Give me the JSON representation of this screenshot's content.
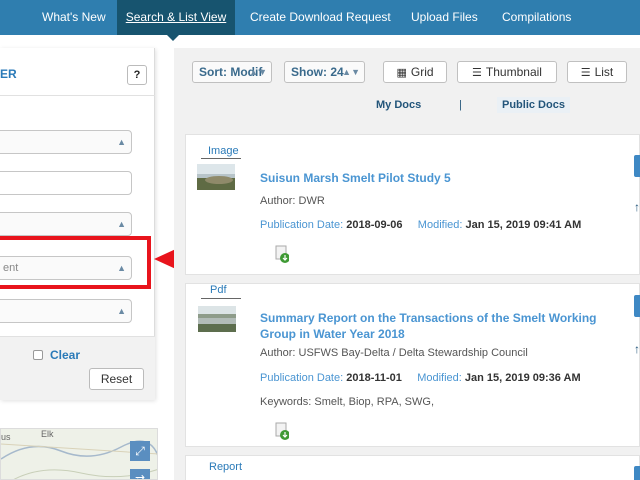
{
  "nav": {
    "items": [
      {
        "label": "What's New"
      },
      {
        "label": "Search & List View",
        "active": true
      },
      {
        "label": "Create Download Request"
      },
      {
        "label": "Upload Files"
      },
      {
        "label": "Compilations"
      }
    ],
    "colors": {
      "bar": "#2f7eaf",
      "active": "#17546f"
    }
  },
  "filter": {
    "title": "ER",
    "help_label": "?",
    "selected_text": "ent",
    "clear_label": "Clear",
    "reset_label": "Reset"
  },
  "toolbar": {
    "sort_label": "Sort: Modif",
    "show_label": "Show: 24",
    "grid_label": "Grid",
    "thumbnail_label": "Thumbnail",
    "list_label": "List"
  },
  "tabs": {
    "my_docs": "My Docs",
    "separator": "|",
    "public_docs": "Public Docs"
  },
  "results": [
    {
      "type": "Image",
      "title": "Suisun Marsh Smelt Pilot Study 5",
      "author": "Author: DWR",
      "pub_label": "Publication Date:",
      "pub_date": "2018-09-06",
      "mod_label": "Modified:",
      "mod_date": "Jan 15, 2019 09:41 AM"
    },
    {
      "type": "Pdf",
      "title": "Summary Report on the Transactions of the Smelt Working Group in Water Year 2018",
      "author": "Author: USFWS Bay-Delta / Delta Stewardship Council",
      "pub_label": "Publication Date:",
      "pub_date": "2018-11-01",
      "mod_label": "Modified:",
      "mod_date": "Jan 15, 2019 09:36 AM",
      "keywords": "Keywords: Smelt, Biop, RPA, SWG,"
    },
    {
      "type": "Report"
    }
  ],
  "map": {
    "labels": [
      "us",
      "Elk"
    ]
  },
  "annotation": {
    "color": "#e8141c"
  }
}
